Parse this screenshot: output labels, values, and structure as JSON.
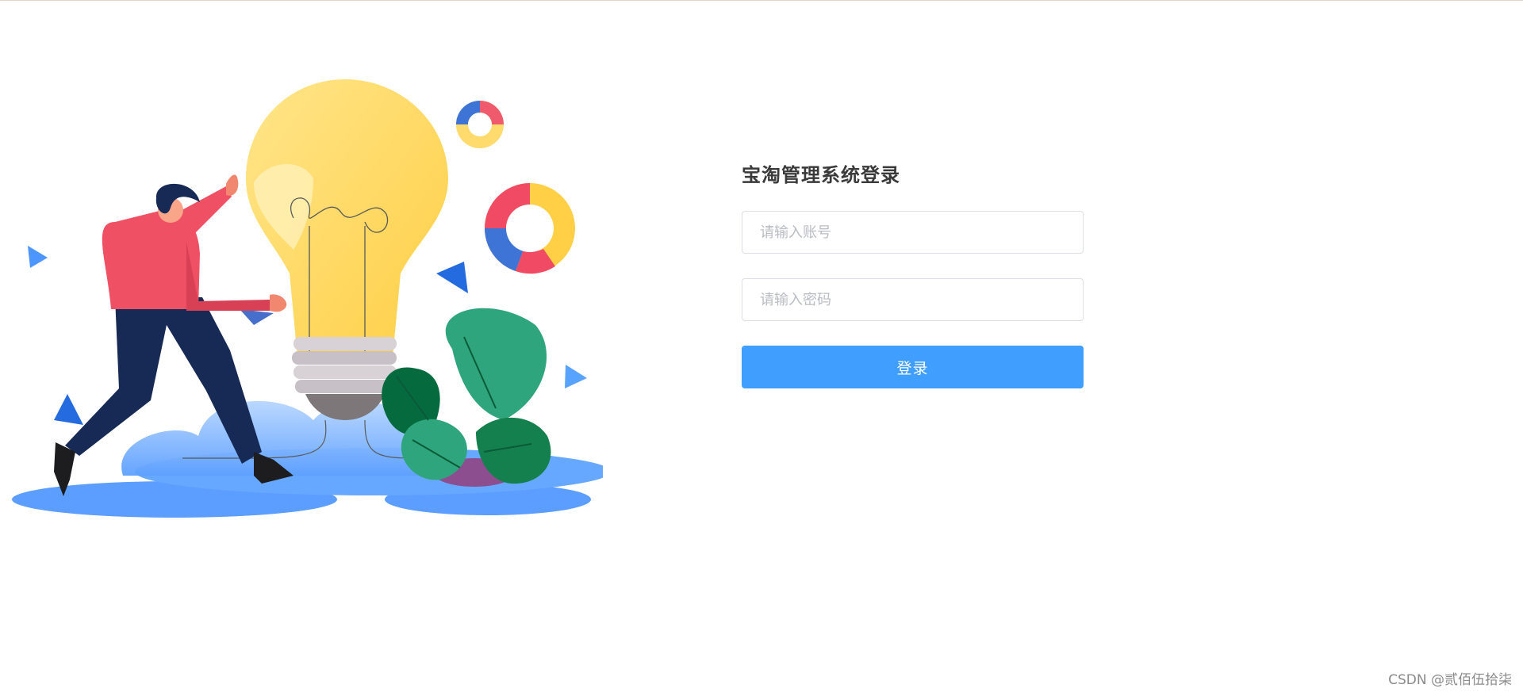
{
  "login": {
    "title": "宝淘管理系统登录",
    "account_placeholder": "请输入账号",
    "password_placeholder": "请输入密码",
    "submit_label": "登录"
  },
  "watermark": "CSDN @贰佰伍拾柒",
  "colors": {
    "primary_button": "#409eff",
    "title_text": "#3a3a3a",
    "input_border": "#dcdfe6",
    "placeholder": "#b9bcc2"
  },
  "illustration": {
    "icon": "person-with-lightbulb-illustration"
  }
}
